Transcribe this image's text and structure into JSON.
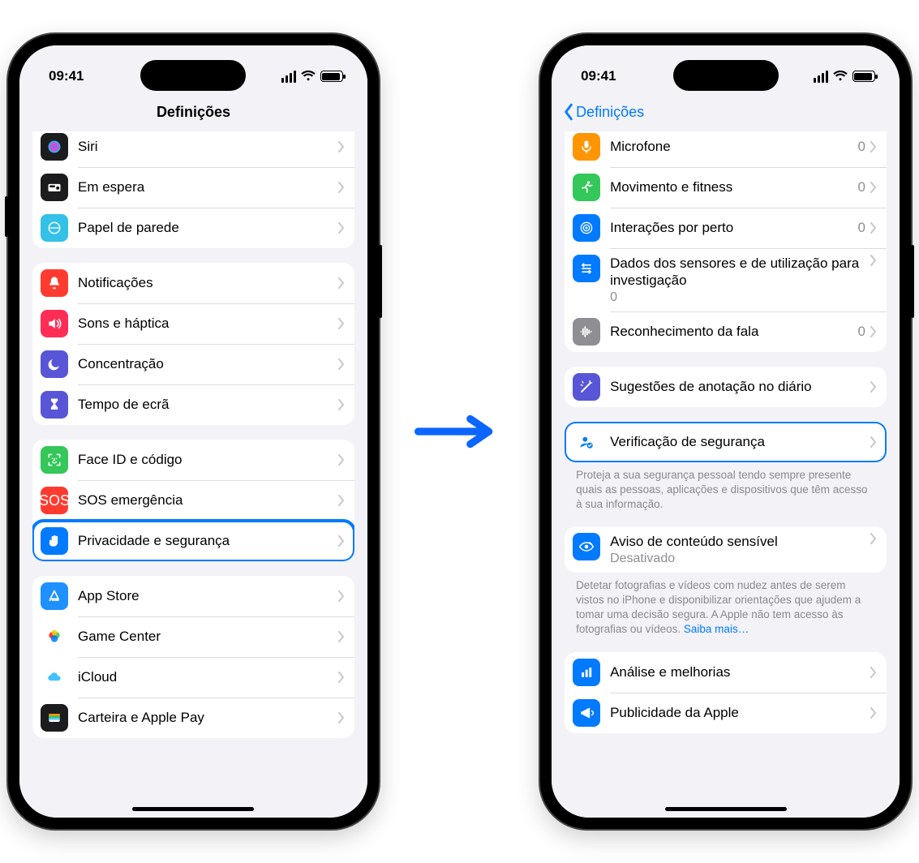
{
  "status": {
    "time": "09:41"
  },
  "phone_left": {
    "title": "Definições",
    "groups": [
      {
        "partial_top": true,
        "rows": [
          {
            "id": "siri",
            "label": "Siri",
            "icon": "siri",
            "color": "#1c1c1e"
          },
          {
            "id": "standby",
            "label": "Em espera",
            "icon": "standby",
            "color": "#1c1c1e"
          },
          {
            "id": "wallpaper",
            "label": "Papel de parede",
            "icon": "wallpaper",
            "color": "#33c1e8"
          }
        ]
      },
      {
        "rows": [
          {
            "id": "notifications",
            "label": "Notificações",
            "icon": "bell",
            "color": "#ff3b30"
          },
          {
            "id": "sounds",
            "label": "Sons e háptica",
            "icon": "speaker",
            "color": "#ff2d55"
          },
          {
            "id": "focus",
            "label": "Concentração",
            "icon": "moon",
            "color": "#5856d6"
          },
          {
            "id": "screentime",
            "label": "Tempo de ecrã",
            "icon": "hourglass",
            "color": "#5856d6"
          }
        ]
      },
      {
        "rows": [
          {
            "id": "faceid",
            "label": "Face ID e código",
            "icon": "faceid",
            "color": "#34c759"
          },
          {
            "id": "sos",
            "label": "SOS emergência",
            "icon": "sos",
            "color": "#ff3b30"
          },
          {
            "id": "privacy",
            "label": "Privacidade e segurança",
            "icon": "hand",
            "color": "#007aff",
            "highlight": true
          }
        ]
      },
      {
        "rows": [
          {
            "id": "appstore",
            "label": "App Store",
            "icon": "appstore",
            "color": "#1e90ff"
          },
          {
            "id": "gamecenter",
            "label": "Game Center",
            "icon": "gamecenter",
            "color": "#ffffff"
          },
          {
            "id": "icloud",
            "label": "iCloud",
            "icon": "icloud",
            "color": "#ffffff"
          },
          {
            "id": "wallet",
            "label": "Carteira e Apple Pay",
            "icon": "wallet",
            "color": "#1c1c1e"
          }
        ]
      }
    ]
  },
  "phone_right": {
    "back": "Definições",
    "groups": [
      {
        "partial_top": true,
        "rows": [
          {
            "id": "mic",
            "label": "Microfone",
            "icon": "mic",
            "color": "#ff9500",
            "detail": "0"
          },
          {
            "id": "motion",
            "label": "Movimento e fitness",
            "icon": "runner",
            "color": "#34c759",
            "detail": "0"
          },
          {
            "id": "nearby",
            "label": "Interações por perto",
            "icon": "nearby",
            "color": "#007aff",
            "detail": "0"
          },
          {
            "id": "research",
            "label": "Dados dos sensores e de utilização para investigação",
            "sub": "0",
            "icon": "research",
            "color": "#007aff",
            "multiline": true
          },
          {
            "id": "speech",
            "label": "Reconhecimento da fala",
            "icon": "waveform",
            "color": "#8e8e93",
            "detail": "0"
          }
        ]
      },
      {
        "rows": [
          {
            "id": "journal",
            "label": "Sugestões de anotação no diário",
            "icon": "wand",
            "color": "#5856d6"
          }
        ]
      },
      {
        "rows": [
          {
            "id": "safetycheck",
            "label": "Verificação de segurança",
            "icon": "personcheck",
            "color": "#007aff",
            "highlight": true,
            "blue_icon": true
          }
        ],
        "footer": "Proteja a sua segurança pessoal tendo sempre presente quais as pessoas, aplicações e dispositivos que têm acesso à sua informação."
      },
      {
        "rows": [
          {
            "id": "sensitive",
            "label": "Aviso de conteúdo sensível",
            "sub": "Desativado",
            "icon": "eye",
            "color": "#007aff",
            "multiline": true
          }
        ],
        "footer": "Detetar fotografias e vídeos com nudez antes de serem vistos no iPhone e disponibilizar orientações que ajudem a tomar uma decisão segura. A Apple não tem acesso às fotografias ou vídeos. ",
        "footer_link": "Saiba mais…"
      },
      {
        "rows": [
          {
            "id": "analytics",
            "label": "Análise e melhorias",
            "icon": "chart",
            "color": "#007aff"
          },
          {
            "id": "ads",
            "label": "Publicidade da Apple",
            "icon": "megaphone",
            "color": "#007aff"
          }
        ]
      }
    ]
  }
}
